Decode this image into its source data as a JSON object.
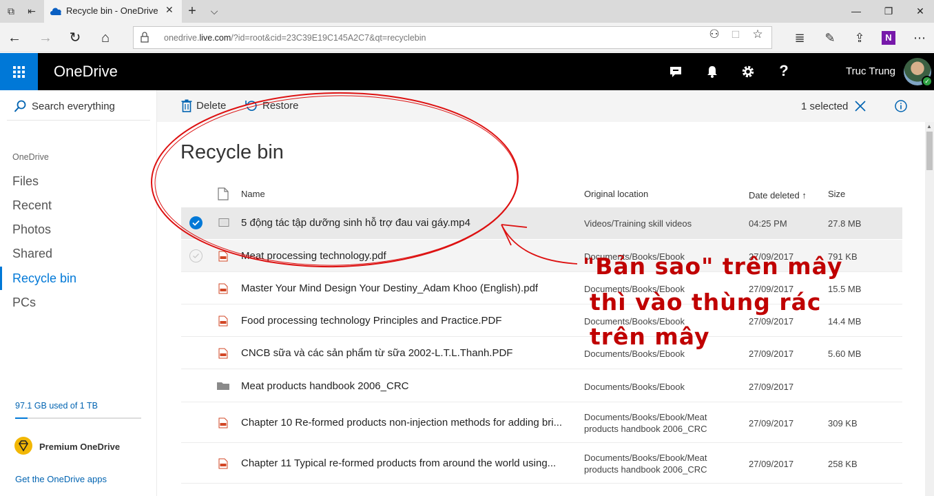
{
  "browser": {
    "tab_title": "Recycle bin - OneDrive",
    "url_prefix": "onedrive.",
    "url_domain": "live.com",
    "url_rest": "/?id=root&cid=23C39E19C145A2C7&qt=recyclebin"
  },
  "suite": {
    "app_name": "OneDrive",
    "help_label": "?",
    "user_name": "Truc Trung"
  },
  "nav": {
    "search_placeholder": "Search everything",
    "section": "OneDrive",
    "items": [
      "Files",
      "Recent",
      "Photos",
      "Shared",
      "Recycle bin",
      "PCs"
    ],
    "active_index": 4,
    "quota_text": "97.1 GB used of 1 TB",
    "quota_fraction": 0.097,
    "premium_label": "Premium OneDrive",
    "get_apps_label": "Get the OneDrive apps"
  },
  "commands": {
    "delete_label": "Delete",
    "restore_label": "Restore",
    "selected_text": "1 selected"
  },
  "page": {
    "title": "Recycle bin"
  },
  "columns": {
    "name": "Name",
    "location": "Original location",
    "date": "Date deleted ↑",
    "size": "Size"
  },
  "files": [
    {
      "name": "5 động tác tập dưỡng sinh hỗ trợ đau vai gáy.mp4",
      "location": "Videos/Training skill videos",
      "date": "04:25 PM",
      "size": "27.8 MB",
      "type": "video",
      "state": "selected"
    },
    {
      "name": "Meat processing technology.pdf",
      "location": "Documents/Books/Ebook",
      "date": "27/09/2017",
      "size": "791 KB",
      "type": "pdf",
      "state": "hover"
    },
    {
      "name": "Master Your Mind Design Your Destiny_Adam Khoo (English).pdf",
      "location": "Documents/Books/Ebook",
      "date": "27/09/2017",
      "size": "15.5 MB",
      "type": "pdf",
      "state": ""
    },
    {
      "name": "Food processing technology Principles and Practice.PDF",
      "location": "Documents/Books/Ebook",
      "date": "27/09/2017",
      "size": "14.4 MB",
      "type": "pdf",
      "state": ""
    },
    {
      "name": "CNCB sữa và các sản phẩm từ sữa 2002-L.T.L.Thanh.PDF",
      "location": "Documents/Books/Ebook",
      "date": "27/09/2017",
      "size": "5.60 MB",
      "type": "pdf",
      "state": ""
    },
    {
      "name": "Meat products handbook 2006_CRC",
      "location": "Documents/Books/Ebook",
      "date": "27/09/2017",
      "size": "",
      "type": "folder",
      "state": ""
    },
    {
      "name": "Chapter 10 Re-formed products non-injection methods for adding bri...",
      "location": "Documents/Books/Ebook/Meat products handbook 2006_CRC",
      "date": "27/09/2017",
      "size": "309 KB",
      "type": "pdf",
      "state": ""
    },
    {
      "name": "Chapter 11 Typical re-formed products from around the world using...",
      "location": "Documents/Books/Ebook/Meat products handbook 2006_CRC",
      "date": "27/09/2017",
      "size": "258 KB",
      "type": "pdf",
      "state": ""
    }
  ],
  "annotation": {
    "lines": [
      "\"Bản sao\" trên mây",
      "thì vào thùng rác",
      "trên mây"
    ],
    "color": "#c00000"
  },
  "colors": {
    "accent": "#0078d7",
    "suite_bar": "#000000",
    "selected_row": "#e9e9e9",
    "pdf_icon": "#d24726"
  }
}
